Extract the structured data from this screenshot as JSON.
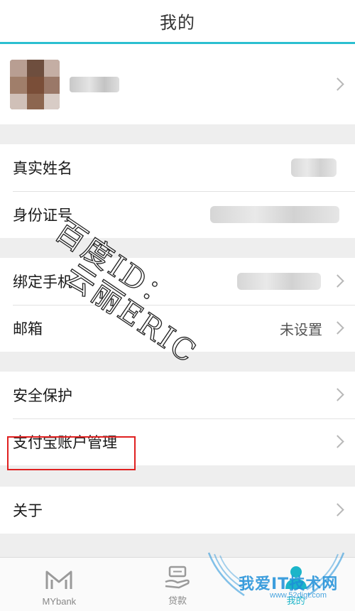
{
  "header": {
    "title": "我的"
  },
  "identity": {
    "real_name_label": "真实姓名",
    "id_number_label": "身份证号"
  },
  "contact": {
    "phone_label": "绑定手机",
    "email_label": "邮箱",
    "email_value": "未设置"
  },
  "security": {
    "protection_label": "安全保护",
    "alipay_label": "支付宝账户管理"
  },
  "about": {
    "label": "关于"
  },
  "tabbar": {
    "items": [
      {
        "label": "MYbank",
        "icon": "mybank-logo-icon"
      },
      {
        "label": "贷款",
        "icon": "loan-icon"
      },
      {
        "label": "我的",
        "icon": "person-icon"
      }
    ]
  },
  "watermark": {
    "line1": "百度ID：",
    "line2": "云丽ERIC"
  },
  "site_logo": {
    "text": "我爱IT技术网",
    "sub": "www.52digt.com"
  },
  "colors": {
    "accent": "#2bbfd0",
    "highlight": "#e02020",
    "logo": "#1d8fd8"
  }
}
